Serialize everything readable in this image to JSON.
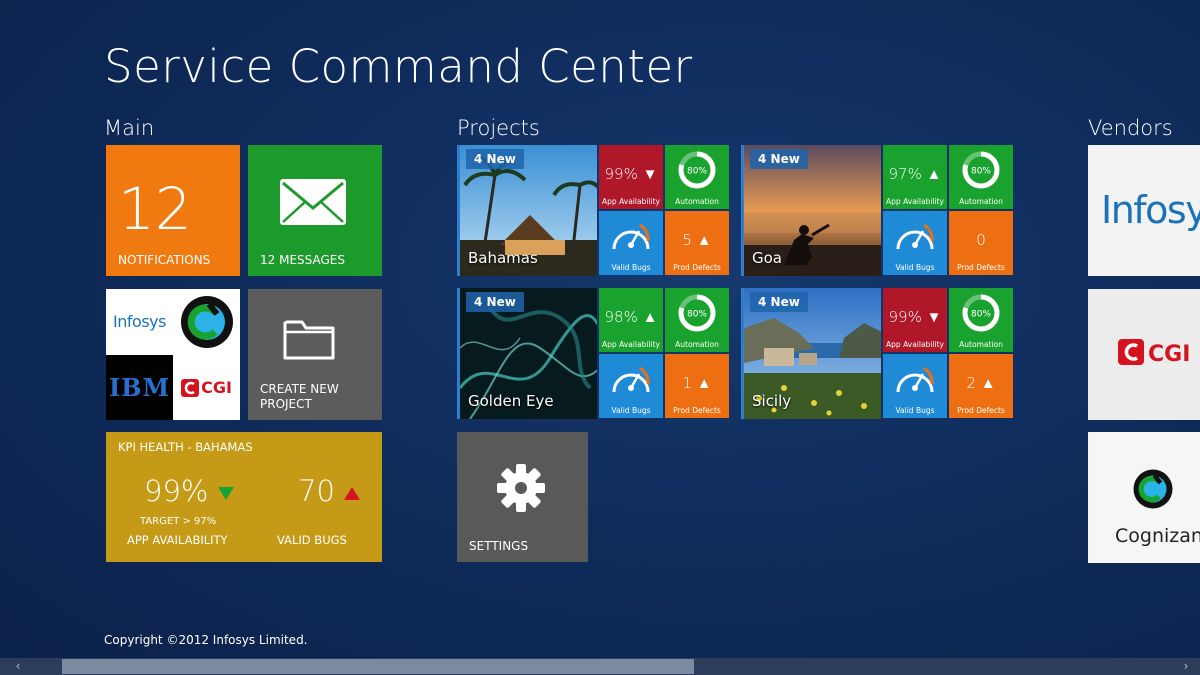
{
  "title": "Service Command Center",
  "groups": {
    "main": "Main",
    "projects": "Projects",
    "vendors": "Vendors"
  },
  "main": {
    "notifications": {
      "count": "12",
      "label": "NOTIFICATIONS"
    },
    "messages": {
      "label": "12 MESSAGES"
    },
    "logos": {
      "infosys": "Infosys",
      "ibm": "IBM",
      "cgi": "CGI"
    },
    "create_project": {
      "line1": "CREATE NEW",
      "line2": "PROJECT"
    },
    "kpi": {
      "header": "KPI HEALTH - BAHAMAS",
      "app_availability_value": "99%",
      "app_availability_label": "APP AVAILABILITY",
      "target": "TARGET  > 97%",
      "valid_bugs_value": "70",
      "valid_bugs_label": "VALID BUGS"
    }
  },
  "projects": [
    {
      "name": "Bahamas",
      "badge": "4 New",
      "availability": "99%",
      "availability_trend": "down",
      "automation": "80%",
      "prod_defects": "5",
      "defects_trend": "up",
      "availability_color": "#b0182a"
    },
    {
      "name": "Goa",
      "badge": "4 New",
      "availability": "97%",
      "availability_trend": "up",
      "automation": "80%",
      "prod_defects": "0",
      "defects_trend": "none",
      "availability_color": "#1aa22e"
    },
    {
      "name": "Golden Eye",
      "badge": "4 New",
      "availability": "98%",
      "availability_trend": "up",
      "automation": "80%",
      "prod_defects": "1",
      "defects_trend": "up",
      "availability_color": "#1aa22e"
    },
    {
      "name": "Sicily",
      "badge": "4 New",
      "availability": "99%",
      "availability_trend": "down",
      "automation": "80%",
      "prod_defects": "2",
      "defects_trend": "up",
      "availability_color": "#b0182a"
    }
  ],
  "mini_labels": {
    "availability": "App Availability",
    "automation": "Automation",
    "bugs": "Valid Bugs",
    "defects": "Prod Defects"
  },
  "settings": {
    "label": "SETTINGS"
  },
  "vendors": {
    "infosys": "Infosys",
    "cgi": "CGI",
    "cognizant": "Cognizant"
  },
  "copyright": "Copyright ©2012 Infosys Limited.",
  "icons": {
    "envelope": "envelope-icon",
    "folder": "folder-icon",
    "gear": "gear-icon",
    "gauge": "gauge-icon",
    "ring": "progress-ring-icon"
  }
}
